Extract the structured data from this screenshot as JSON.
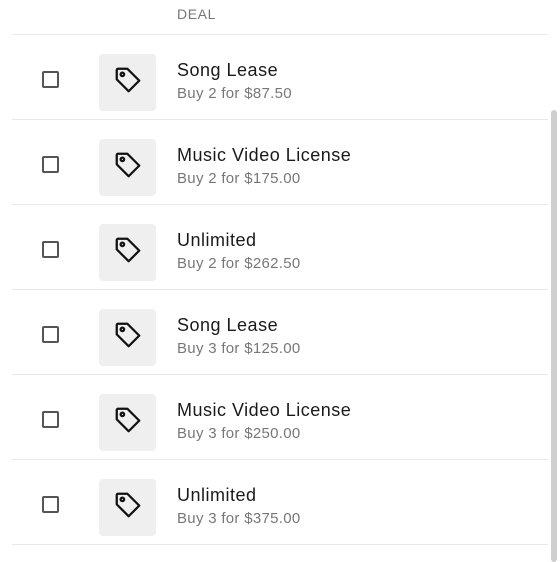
{
  "header": {
    "label": "DEAL"
  },
  "deals": [
    {
      "title": "Song Lease",
      "subtitle": "Buy 2 for $87.50",
      "icon": "tag-icon"
    },
    {
      "title": "Music Video License",
      "subtitle": "Buy 2 for $175.00",
      "icon": "tag-icon"
    },
    {
      "title": "Unlimited",
      "subtitle": "Buy 2 for $262.50",
      "icon": "tag-icon"
    },
    {
      "title": "Song Lease",
      "subtitle": "Buy 3 for $125.00",
      "icon": "tag-icon"
    },
    {
      "title": "Music Video License",
      "subtitle": "Buy 3 for $250.00",
      "icon": "tag-icon"
    },
    {
      "title": "Unlimited",
      "subtitle": "Buy 3 for $375.00",
      "icon": "tag-icon"
    }
  ],
  "colors": {
    "text": "#1a1a1a",
    "muted": "#777777",
    "thumb_bg": "#efefef",
    "divider": "#e8e8e8"
  }
}
